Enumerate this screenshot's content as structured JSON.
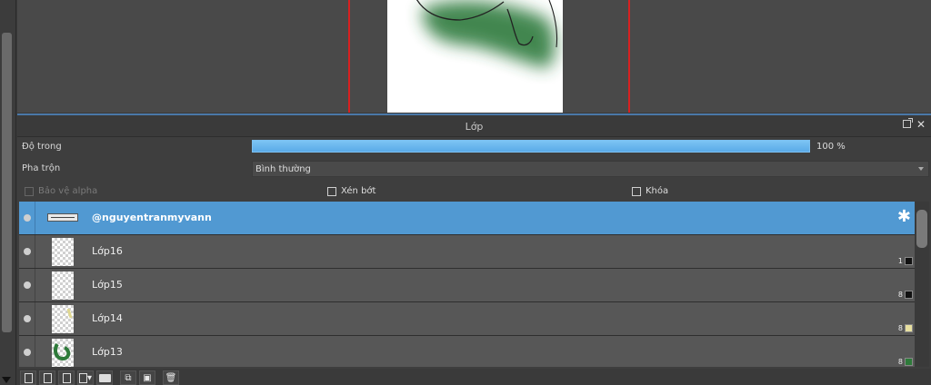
{
  "panel": {
    "title": "Lớp",
    "opacity_label": "Độ trong",
    "opacity_value_text": "100 %",
    "opacity_percent": 100,
    "blend_label": "Pha trộn",
    "blend_value": "Bình thường",
    "protect_alpha_label": "Bảo vệ alpha",
    "clipping_label": "Xén bớt",
    "lock_label": "Khóa"
  },
  "layers": [
    {
      "name": "@nguyentranmyvann",
      "selected": true,
      "type": "text"
    },
    {
      "name": "Lớp16",
      "tag": "1",
      "color": "#111111"
    },
    {
      "name": "Lớp15",
      "tag": "8",
      "color": "#111111"
    },
    {
      "name": "Lớp14",
      "tag": "8",
      "color": "#e8e0a0"
    },
    {
      "name": "Lớp13",
      "tag": "8",
      "color": "#2e7a3a"
    }
  ],
  "colors": {
    "accent": "#5199d2",
    "guide_line": "#d82020"
  }
}
